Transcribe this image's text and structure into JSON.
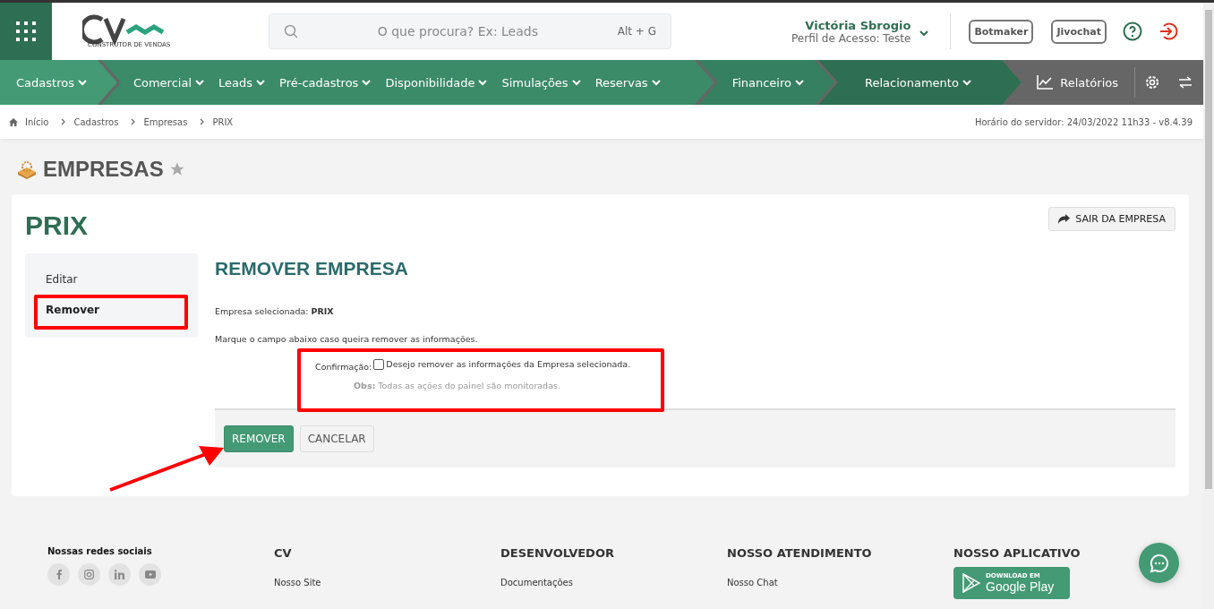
{
  "header": {
    "search": {
      "placeholder": "O que procura? Ex: Leads",
      "shortcut": "Alt + G"
    },
    "logo": {
      "tagline": "CONSTRUTOR DE VENDAS"
    },
    "user": {
      "name": "Victória Sbrogio",
      "profile": "Perfil de Acesso: Teste"
    },
    "buttons": [
      "Botmaker",
      "Jivochat"
    ]
  },
  "nav": {
    "groups": [
      {
        "items": [
          "Cadastros"
        ]
      },
      {
        "items": [
          "Comercial",
          "Leads",
          "Pré-cadastros",
          "Disponibilidade",
          "Simulações",
          "Reservas"
        ]
      },
      {
        "items": [
          "Financeiro"
        ]
      },
      {
        "items": [
          "Relacionamento"
        ]
      }
    ],
    "reports": "Relatórios"
  },
  "breadcrumb": {
    "items": [
      "Início",
      "Cadastros",
      "Empresas",
      "PRIX"
    ],
    "server_time": "Horário do servidor: 24/03/2022 11h33 - v8.4.39"
  },
  "page_title": "EMPRESAS",
  "card": {
    "title": "PRIX",
    "exit_button": "SAIR DA EMPRESA",
    "menu": [
      {
        "label": "Editar",
        "selected": false
      },
      {
        "label": "Remover",
        "selected": true
      }
    ],
    "section_title": "REMOVER EMPRESA",
    "selected_company": "Empresa selecionada: **PRIX**",
    "instruction": "Marque o campo abaixo caso queira remover as informações.",
    "confirmation": {
      "label": "Confirmação:",
      "checkbox_label": "Desejo remover as informações da Empresa selecionada.",
      "checked": false,
      "note": "**Obs:** Todas as ações do painel são monitoradas."
    },
    "actions": [
      "REMOVER",
      "CANCELAR"
    ]
  },
  "footer": {
    "columns": [
      {
        "kind": "social",
        "title": "Nossas redes sociais"
      },
      {
        "kind": "links",
        "title": "CV",
        "links": [
          "Nosso Site"
        ]
      },
      {
        "kind": "links",
        "title": "DESENVOLVEDOR",
        "links": [
          "Documentações"
        ]
      },
      {
        "kind": "links",
        "title": "NOSSO ATENDIMENTO",
        "links": [
          "Nosso Chat"
        ]
      },
      {
        "kind": "app",
        "title": "NOSSO APLICATIVO",
        "badge_small": "DOWNLOAD EM",
        "badge_big": "Google Play"
      }
    ]
  }
}
